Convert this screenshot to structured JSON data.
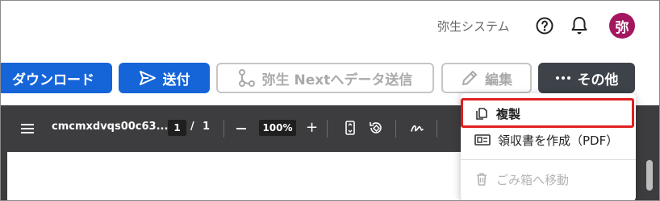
{
  "header": {
    "company_name": "弥生システム",
    "help_icon": "question-circle-icon",
    "notification_icon": "bell-icon",
    "avatar_text": "弥",
    "avatar_color": "#a4175f"
  },
  "actions": {
    "download_label": "ダウンロード",
    "send_label": "送付",
    "yayoi_send_label": "弥生 Nextへデータ送信",
    "edit_label": "編集",
    "more_label": "その他",
    "primary_color": "#1565d8",
    "more_color": "#3e4249"
  },
  "viewer": {
    "file_name": "cmcmxdvqs00c63...",
    "current_page": "1",
    "page_separator": "/",
    "total_pages": "1",
    "zoom": "100%",
    "zoom_in_symbol": "+",
    "background_color": "#3d3d3f"
  },
  "more_menu": {
    "items": [
      {
        "label": "複製",
        "icon": "copy-icon",
        "enabled": true,
        "highlighted": true
      },
      {
        "label": "領収書を作成（PDF）",
        "icon": "receipt-icon",
        "enabled": true
      },
      {
        "label": "ごみ箱へ移動",
        "icon": "trash-icon",
        "enabled": false
      }
    ],
    "highlight_color": "#e01f1f"
  }
}
